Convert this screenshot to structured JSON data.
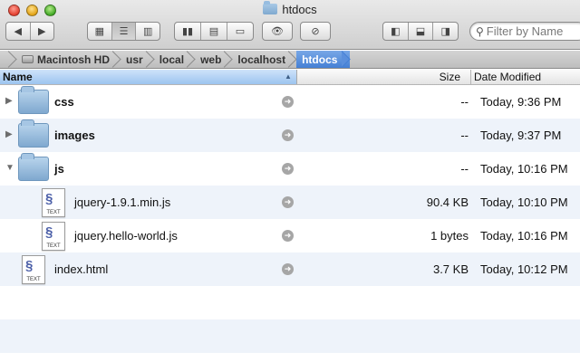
{
  "window": {
    "title": "htdocs"
  },
  "toolbar": {
    "back_icon": "chevron-left-icon",
    "forward_icon": "chevron-right-icon",
    "view_modes": [
      "icon-view-icon",
      "list-view-icon",
      "column-view-icon"
    ],
    "active_view": "list",
    "search_placeholder": "Filter by Name"
  },
  "path": {
    "items": [
      "Macintosh HD",
      "usr",
      "local",
      "web",
      "localhost",
      "htdocs"
    ]
  },
  "columns": {
    "name": "Name",
    "size": "Size",
    "date": "Date Modified"
  },
  "rows": [
    {
      "name": "css",
      "kind": "folder",
      "size": "--",
      "date": "Today, 9:36 PM",
      "expanded": false
    },
    {
      "name": "images",
      "kind": "folder",
      "size": "--",
      "date": "Today, 9:37 PM",
      "expanded": false
    },
    {
      "name": "js",
      "kind": "folder",
      "size": "--",
      "date": "Today, 10:16 PM",
      "expanded": true
    },
    {
      "name": "jquery-1.9.1.min.js",
      "kind": "text",
      "size": "90.4 KB",
      "date": "Today, 10:10 PM",
      "icon_label": "TEXT"
    },
    {
      "name": "jquery.hello-world.js",
      "kind": "text",
      "size": "1 bytes",
      "date": "Today, 10:16 PM",
      "icon_label": "TEXT"
    },
    {
      "name": "index.html",
      "kind": "text",
      "size": "3.7 KB",
      "date": "Today, 10:12 PM",
      "icon_label": "TEXT"
    }
  ],
  "colors": {
    "selection_blue": "#4580d5",
    "row_alt": "#eef3fa"
  }
}
